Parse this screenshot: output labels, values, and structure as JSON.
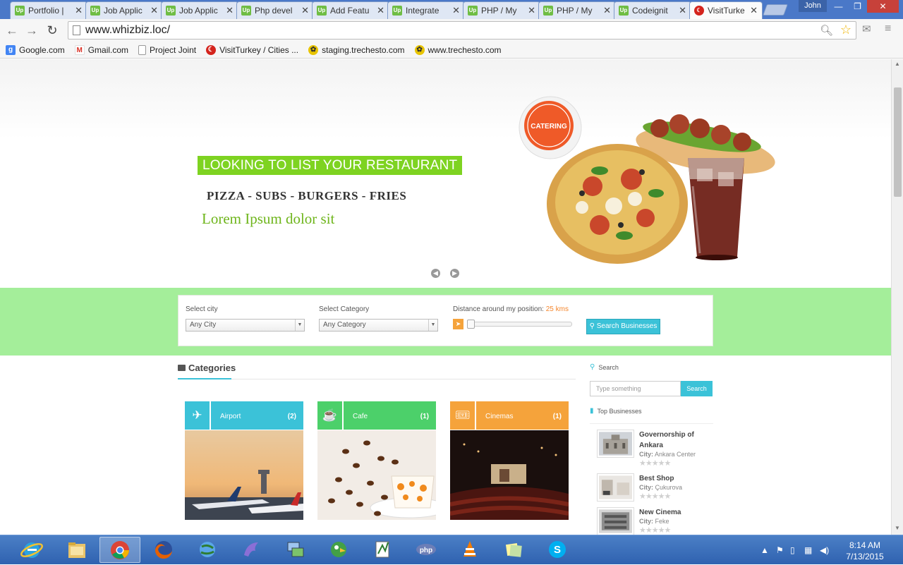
{
  "browser": {
    "tabs": [
      {
        "title": "Portfolio |",
        "favicon": "Up"
      },
      {
        "title": "Job Applic",
        "favicon": "Up"
      },
      {
        "title": "Job Applic",
        "favicon": "Up"
      },
      {
        "title": "Php devel",
        "favicon": "Up"
      },
      {
        "title": "Add Featu",
        "favicon": "Up"
      },
      {
        "title": "Integrate",
        "favicon": "Up"
      },
      {
        "title": "PHP / My",
        "favicon": "Up"
      },
      {
        "title": "PHP / My",
        "favicon": "Up"
      },
      {
        "title": "Codeignit",
        "favicon": "Up"
      },
      {
        "title": "VisitTurke",
        "favicon": "turkey-flag"
      }
    ],
    "profile_name": "John",
    "url": "www.whizbiz.loc/",
    "bookmarks": [
      {
        "label": "Google.com",
        "icon": "google-g-icon",
        "color": "#4285f4"
      },
      {
        "label": "Gmail.com",
        "icon": "gmail-icon",
        "color": "#d93025"
      },
      {
        "label": "Project Joint",
        "icon": "page-icon",
        "color": "#888888"
      },
      {
        "label": "VisitTurkey / Cities ...",
        "icon": "turkey-flag-icon",
        "color": "#d4241d"
      },
      {
        "label": "staging.trechesto.com",
        "icon": "trechesto-icon",
        "color": "#c9a000"
      },
      {
        "label": "www.trechesto.com",
        "icon": "trechesto-icon",
        "color": "#c9a000"
      }
    ]
  },
  "hero": {
    "tag": "LOOKING TO LIST YOUR RESTAURANT",
    "subtitle": "PIZZA - SUBS - BURGERS - FRIES",
    "tagline": "Lorem Ipsum dolor sit",
    "badge": "CATERING"
  },
  "search": {
    "city_label": "Select city",
    "city_value": "Any City",
    "category_label": "Select Category",
    "category_value": "Any Category",
    "distance_label": "Distance around my position:",
    "distance_value": "25 kms",
    "distance_level": 0,
    "button": "Search Businesses"
  },
  "categories": {
    "heading": "Categories",
    "items": [
      {
        "name": "Airport",
        "count": "(2)",
        "color": "#3bc2d8",
        "icon": "plane-icon"
      },
      {
        "name": "Cafe",
        "count": "(1)",
        "color": "#4cd06a",
        "icon": "coffee-cup-icon"
      },
      {
        "name": "Cinemas",
        "count": "(1)",
        "color": "#f5a33b",
        "icon": "ticket-icon"
      }
    ]
  },
  "sidebar": {
    "search_label": "Search",
    "search_placeholder": "Type something",
    "search_button": "Search",
    "top_label": "Top Businesses",
    "businesses": [
      {
        "name": "Governorship of Ankara",
        "city_label": "City:",
        "city": "Ankara Center",
        "rating": 0
      },
      {
        "name": "Best Shop",
        "city_label": "City:",
        "city": "Çukurova",
        "rating": 0
      },
      {
        "name": "New Cinema",
        "city_label": "City:",
        "city": "Feke",
        "rating": 0
      }
    ]
  },
  "taskbar": {
    "time": "8:14 AM",
    "date": "7/13/2015"
  }
}
